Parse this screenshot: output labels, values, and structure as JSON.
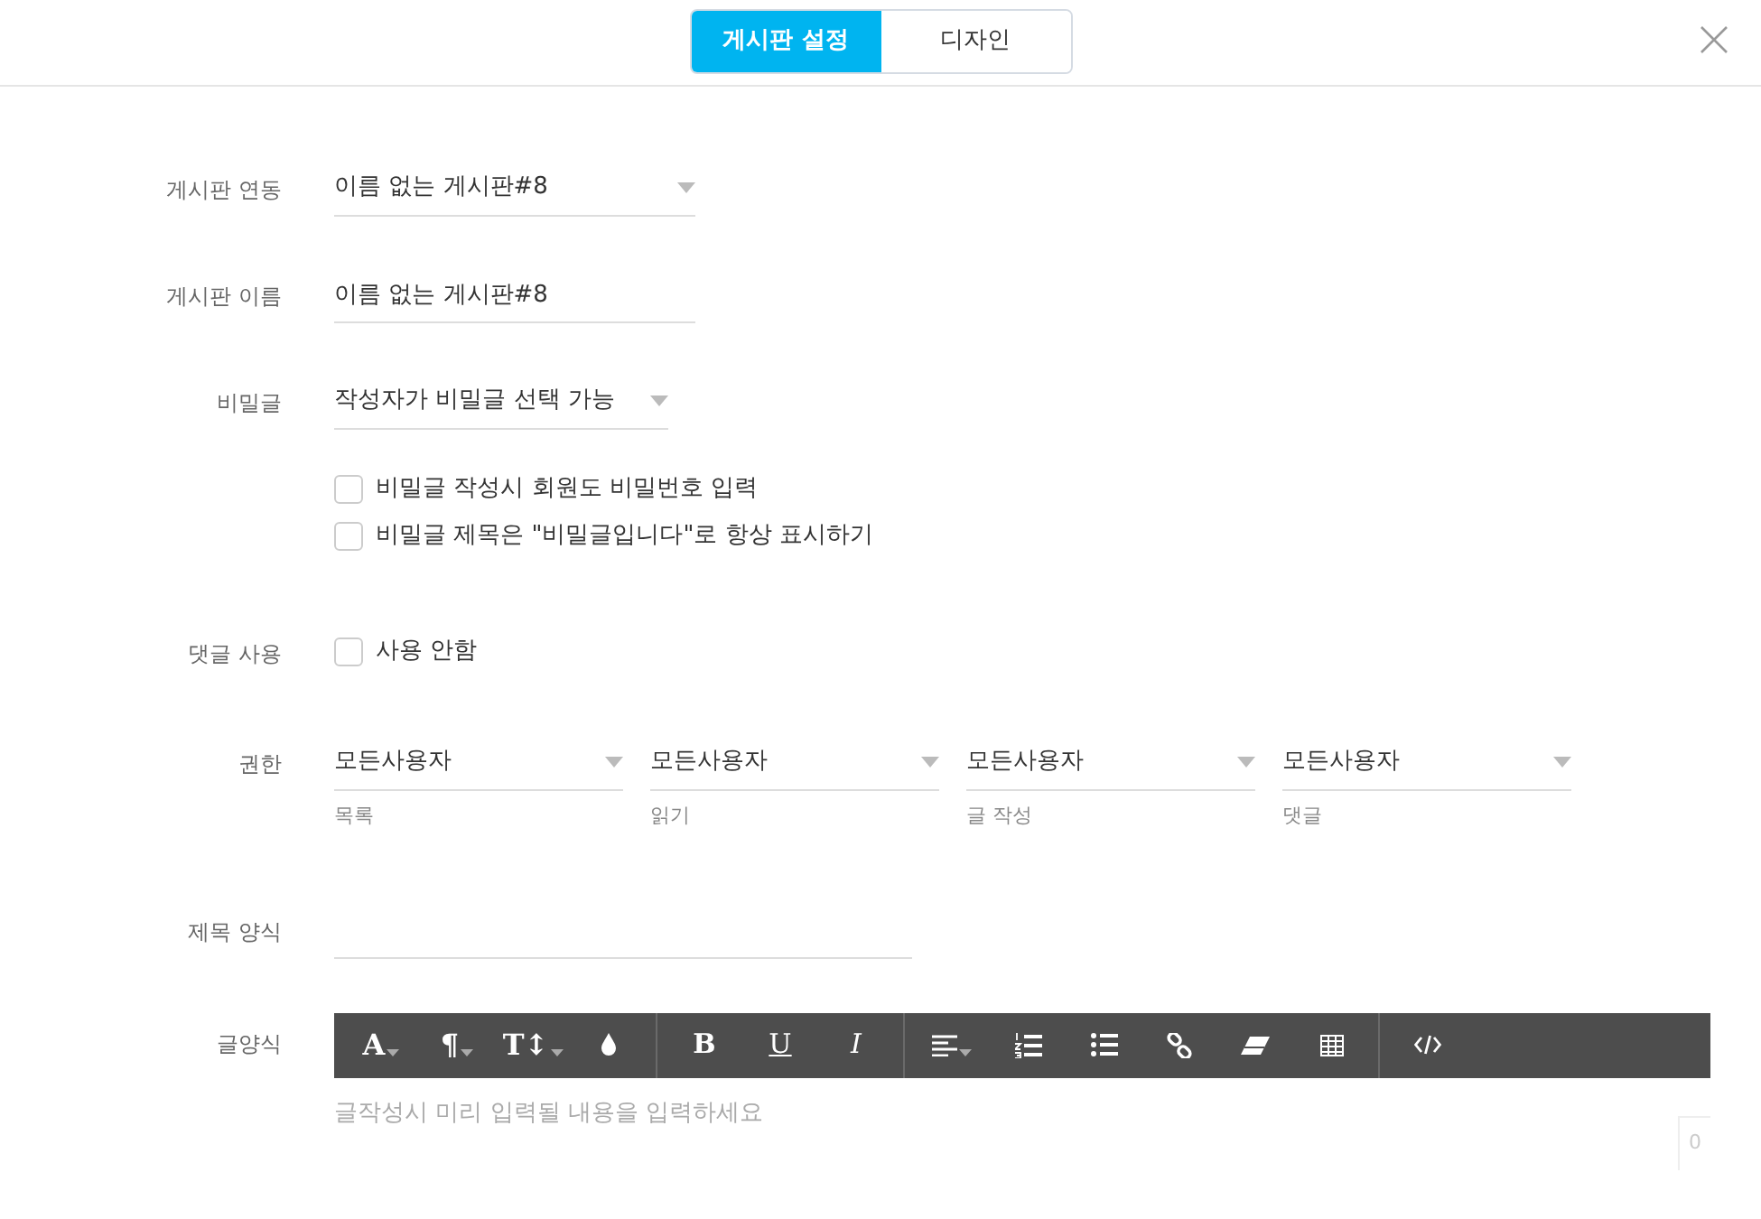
{
  "tabs": [
    {
      "label": "게시판 설정",
      "selected": true
    },
    {
      "label": "디자인",
      "selected": false
    }
  ],
  "form": [
    {
      "kind": "select",
      "label": "게시판 연동",
      "value": "이름 없는 게시판#8"
    },
    {
      "kind": "text",
      "label": "게시판 이름",
      "value": "이름 없는 게시판#8"
    },
    {
      "kind": "select",
      "label": "비밀글",
      "value": "작성자가 비밀글 선택 가능",
      "options": [
        {
          "label": "비밀글 작성시 회원도 비밀번호 입력",
          "checked": false
        },
        {
          "label": "비밀글 제목은 \"비밀글입니다\"로 항상 표시하기",
          "checked": false
        }
      ]
    },
    {
      "kind": "checks",
      "label": "댓글 사용",
      "options": [
        {
          "label": "사용 안함",
          "checked": false
        }
      ]
    },
    {
      "kind": "perms",
      "label": "권한",
      "selects": [
        {
          "value": "모든사용자",
          "caption": "목록"
        },
        {
          "value": "모든사용자",
          "caption": "읽기"
        },
        {
          "value": "모든사용자",
          "caption": "글 작성"
        },
        {
          "value": "모든사용자",
          "caption": "댓글"
        }
      ]
    },
    {
      "kind": "text",
      "label": "제목 양식"
    },
    {
      "kind": "editor",
      "label": "글양식",
      "placeholder": "글작성시 미리 입력될 내용을 입력하세요",
      "count": "0",
      "toolbar": [
        [
          {
            "kind": "font",
            "text": "A"
          },
          {
            "kind": "paragraph",
            "text": "¶"
          },
          {
            "kind": "size",
            "text": "T↕"
          },
          {
            "kind": "drop"
          }
        ],
        [
          {
            "kind": "bold",
            "text": "B"
          },
          {
            "kind": "underline",
            "text": "U"
          },
          {
            "kind": "italic",
            "text": "I"
          }
        ],
        [
          {
            "kind": "align"
          },
          {
            "kind": "ol"
          },
          {
            "kind": "ul"
          },
          {
            "kind": "link"
          },
          {
            "kind": "eraser"
          },
          {
            "kind": "table"
          }
        ],
        [
          {
            "kind": "code"
          }
        ]
      ]
    }
  ]
}
